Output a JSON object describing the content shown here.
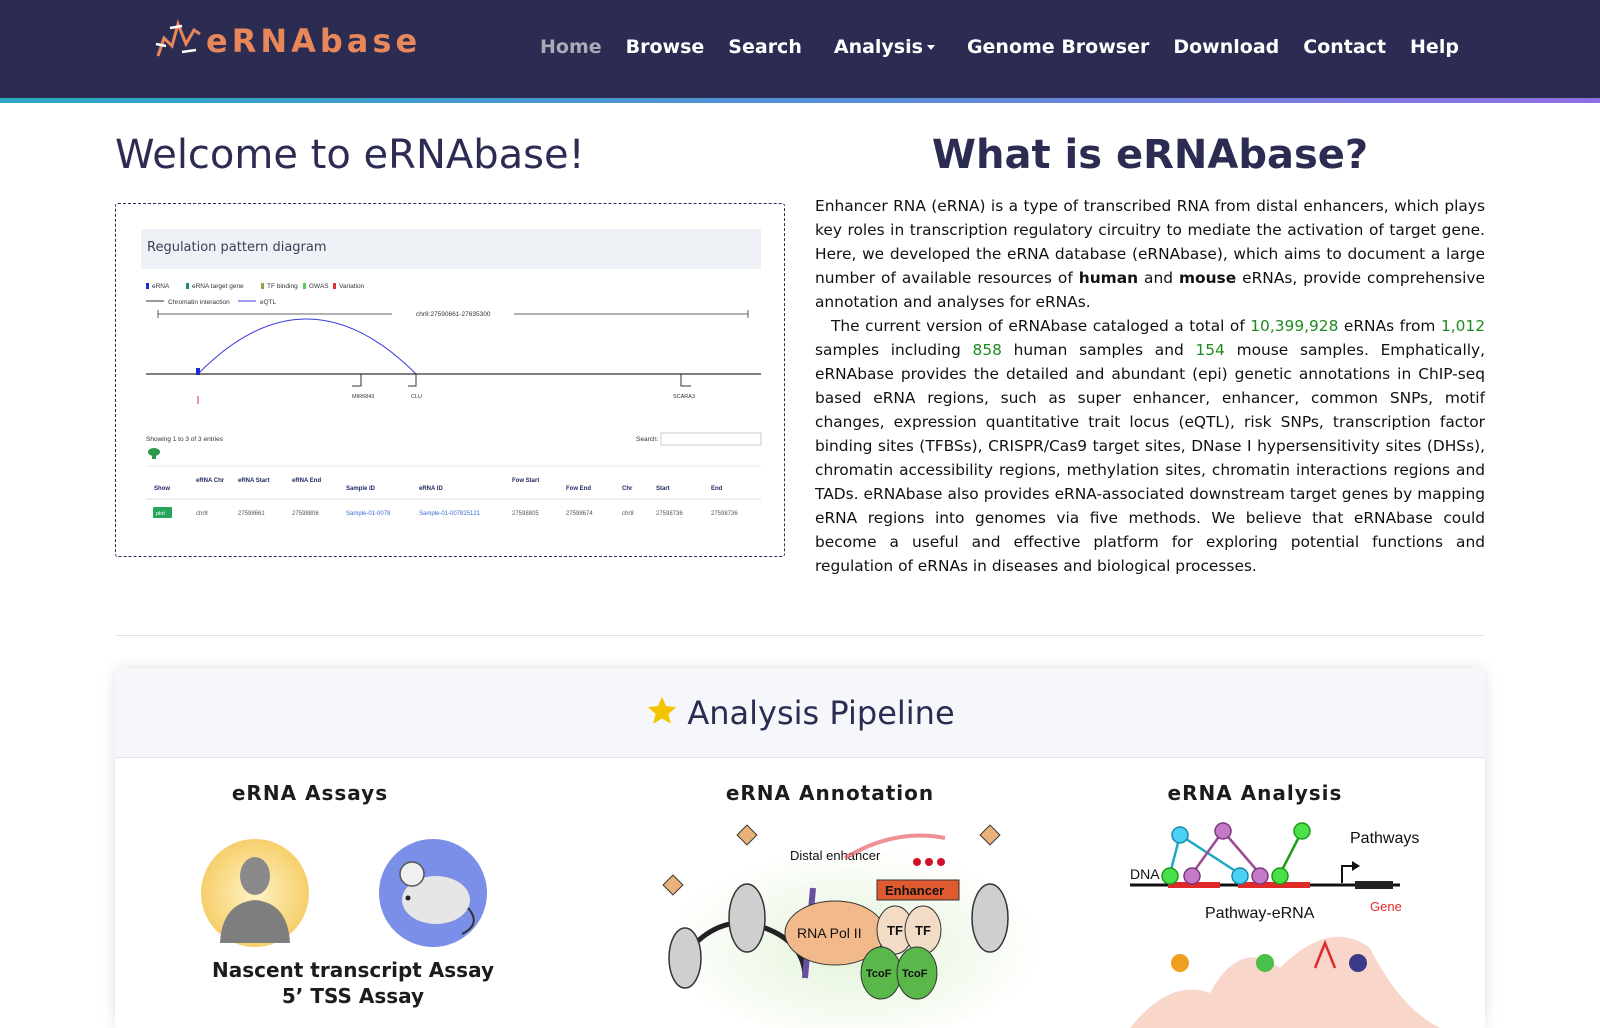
{
  "brand": {
    "name": "eRNAbase"
  },
  "nav": {
    "items": [
      {
        "label": "Home"
      },
      {
        "label": "Browse"
      },
      {
        "label": "Search"
      },
      {
        "label": "Analysis"
      },
      {
        "label": "Genome Browser"
      },
      {
        "label": "Download"
      },
      {
        "label": "Contact"
      },
      {
        "label": "Help"
      }
    ]
  },
  "welcome": {
    "title": "Welcome to eRNAbase!",
    "diagram_header": "Regulation pattern diagram",
    "legend": [
      "eRNA",
      "eRNA target gene",
      "TF binding",
      "GWAS",
      "Variation",
      "Chromatin interaction",
      "eQTL"
    ],
    "coord_label": "chr8:27590661-27635300",
    "gene_labels": [
      "MIR6843",
      "CLU",
      "SCARA3"
    ],
    "showing_text": "Showing 1 to 3 of 3 entries",
    "search_label": "Search:",
    "table_headers": [
      "Show",
      "eRNA Chr",
      "eRNA Start",
      "eRNA End",
      "Sample ID",
      "eRNA ID",
      "Fow Start",
      "Fow End",
      "Chr",
      "Start",
      "End"
    ],
    "table_row": [
      "plot",
      "chr8",
      "27598661",
      "27598806",
      "Sample-01-0078",
      "Sample-01-007825121",
      "27598805",
      "27598674",
      "chr8",
      "27598736",
      "27598736"
    ]
  },
  "what": {
    "title": "What is eRNAbase?",
    "p1_a": "Enhancer RNA (eRNA) is a type of transcribed RNA from distal enhancers, which plays key roles in transcription regulatory circuitry to mediate the activation of target gene. Here, we developed the eRNA database (eRNAbase), which aims to document a large number of available resources of ",
    "p1_human": "human",
    "p1_and": " and ",
    "p1_mouse": "mouse",
    "p1_b": " eRNAs, provide comprehensive annotation and analyses for eRNAs.",
    "p2_a": "The current version of eRNAbase cataloged a total of ",
    "total": "10,399,928",
    "p2_b": " eRNAs from ",
    "samples": "1,012",
    "p2_c": " samples including ",
    "human_samples": "858",
    "p2_d": " human samples and ",
    "mouse_samples": "154",
    "p2_e": " mouse samples. Emphatically, eRNAbase provides the detailed and abundant (epi) genetic annotations in ChIP-seq based eRNA regions, such as super enhancer, enhancer, common SNPs, motif changes, expression quantitative trait locus (eQTL), risk SNPs, transcription factor binding sites (TFBSs), CRISPR/Cas9 target sites, DNase I hypersensitivity sites (DHSs), chromatin accessibility regions, methylation sites, chromatin interactions regions and TADs. eRNAbase also provides eRNA-associated downstream target genes by mapping eRNA regions into genomes via five methods. We believe that eRNAbase could become a useful and effective platform for exploring potential functions and regulation of eRNAs in diseases and biological processes."
  },
  "pipeline": {
    "title": "Analysis Pipeline",
    "columns": [
      {
        "title": "eRNA Assays"
      },
      {
        "title": "eRNA Annotation"
      },
      {
        "title": "eRNA Analysis"
      }
    ],
    "assay_line1": "Nascent transcript Assay",
    "assay_line2": "5’ TSS Assay",
    "annotation_labels": {
      "distal": "Distal enhancer",
      "enhancer": "Enhancer",
      "polii": "RNA Pol II",
      "tf": "TF",
      "tcof": "TcoF"
    },
    "analysis_labels": {
      "pathways": "Pathways",
      "dna": "DNA",
      "pathway_erna": "Pathway-eRNA",
      "gene": "Gene"
    }
  },
  "colors": {
    "navbar": "#2c2b51",
    "brand": "#e8875a",
    "accent_green": "#1f8a1f"
  }
}
